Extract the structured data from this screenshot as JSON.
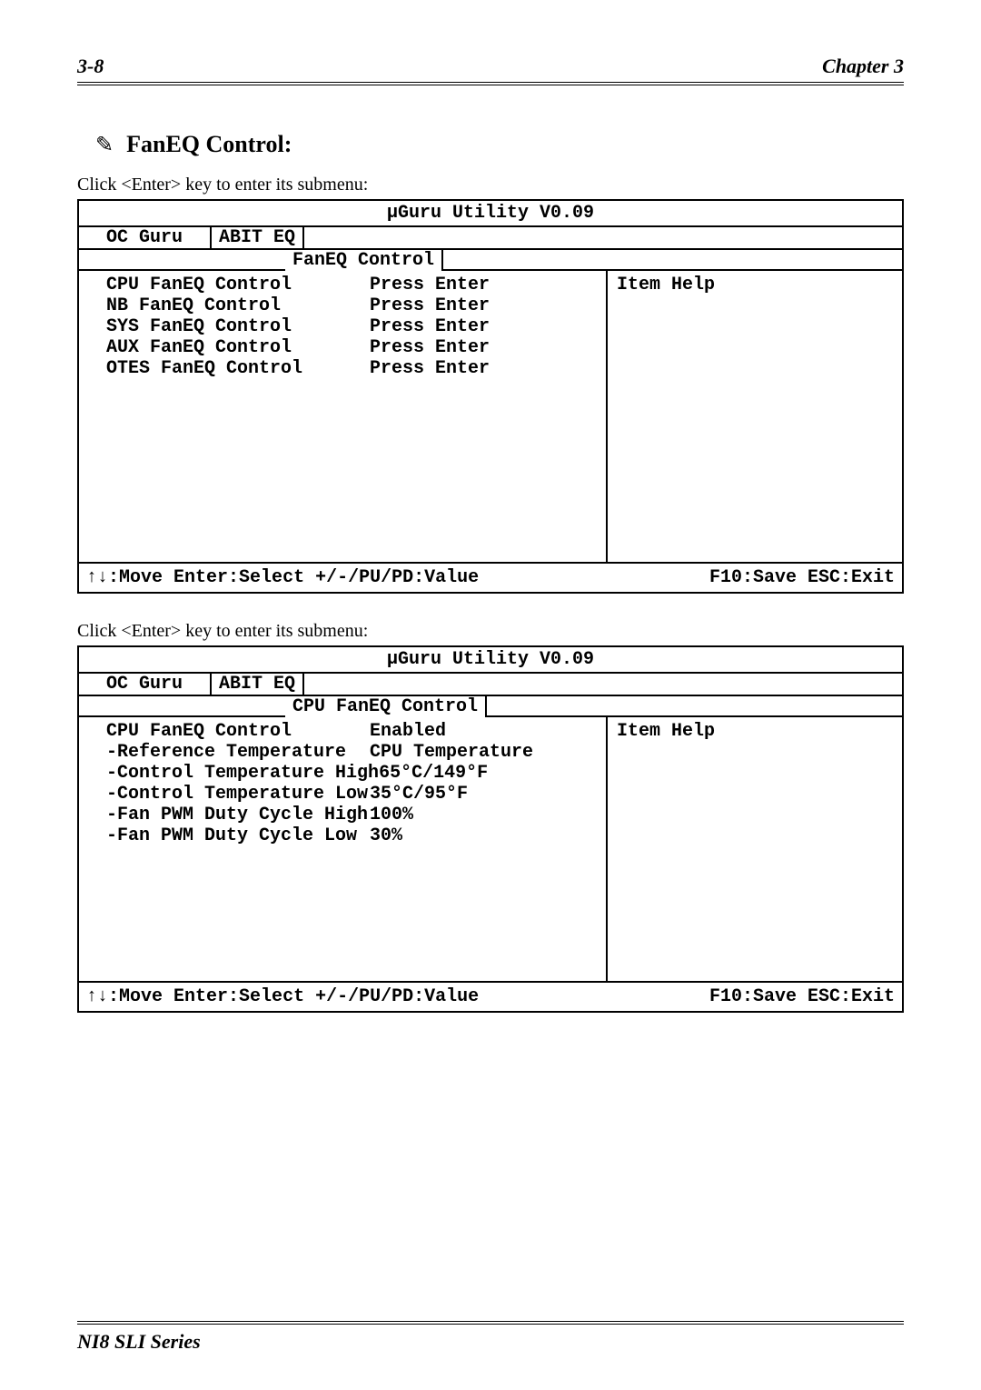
{
  "header": {
    "page_num": "3-8",
    "chapter": "Chapter 3"
  },
  "section": {
    "icon": "✎",
    "title": "FanEQ Control:"
  },
  "caption1": "Click <Enter> key to enter its submenu:",
  "bios1": {
    "title": "µGuru Utility V0.09",
    "tab_inactive": "OC Guru",
    "tab_active": "ABIT EQ",
    "subtab": "FanEQ Control",
    "help_heading": "Item Help",
    "items": [
      {
        "label": "CPU FanEQ Control",
        "value": "Press Enter"
      },
      {
        "label": "NB FanEQ Control",
        "value": "Press Enter"
      },
      {
        "label": "SYS FanEQ Control",
        "value": "Press Enter"
      },
      {
        "label": "AUX FanEQ Control",
        "value": "Press Enter"
      },
      {
        "label": "OTES FanEQ Control",
        "value": "Press Enter"
      }
    ],
    "footer_left": ":Move Enter:Select +/-/PU/PD:Value",
    "footer_right": "F10:Save ESC:Exit"
  },
  "caption2": "Click <Enter> key to enter its submenu:",
  "bios2": {
    "title": "µGuru Utility V0.09",
    "tab_inactive": "OC Guru",
    "tab_active": "ABIT EQ",
    "subtab": "CPU FanEQ Control",
    "help_heading": "Item Help",
    "items": [
      {
        "label": "CPU FanEQ Control",
        "value": "Enabled"
      },
      {
        "label": "-Reference Temperature",
        "value": "CPU Temperature"
      },
      {
        "label": "-Control Temperature High",
        "value": "65°C/149°F"
      },
      {
        "label": "-Control Temperature Low",
        "value": "35°C/95°F"
      },
      {
        "label": "-Fan PWM Duty Cycle High",
        "value": "100%"
      },
      {
        "label": "-Fan PWM Duty Cycle Low",
        "value": "30%"
      }
    ],
    "footer_left": ":Move Enter:Select +/-/PU/PD:Value",
    "footer_right": "F10:Save ESC:Exit"
  },
  "footer": {
    "series": "NI8 SLI Series"
  }
}
